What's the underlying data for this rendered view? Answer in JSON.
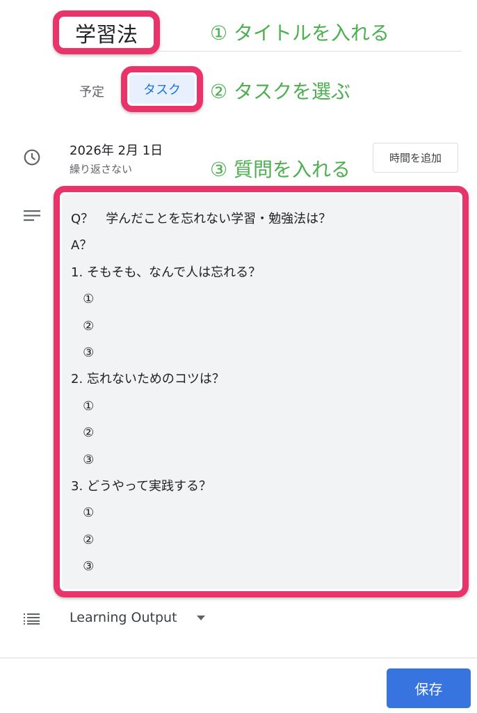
{
  "title": {
    "value": "学習法"
  },
  "annotations": {
    "step1": "① タイトルを入れる",
    "step2": "② タスクを選ぶ",
    "step3": "③ 質問を入れる"
  },
  "type_selector": {
    "event_label": "予定",
    "task_label": "タスク"
  },
  "date": {
    "value": "2026年 2月 1日",
    "repeat": "繰り返さない",
    "add_time_label": "時間を追加"
  },
  "description": {
    "lines": [
      "Q？　学んだことを忘れない学習・勉強法は？",
      "A？",
      "1. そもそも、なんで人は忘れる？",
      "   ①",
      "   ②",
      "   ③",
      "2. 忘れないためのコツは？",
      "   ①",
      "   ②",
      "   ③",
      "3. どうやって実践する？",
      "   ①",
      "   ②",
      "   ③"
    ]
  },
  "task_list": {
    "selected": "Learning Output"
  },
  "footer": {
    "save_label": "保存"
  },
  "colors": {
    "highlight": "#e8336b",
    "annotation": "#4caf50",
    "accent": "#3874e0"
  }
}
